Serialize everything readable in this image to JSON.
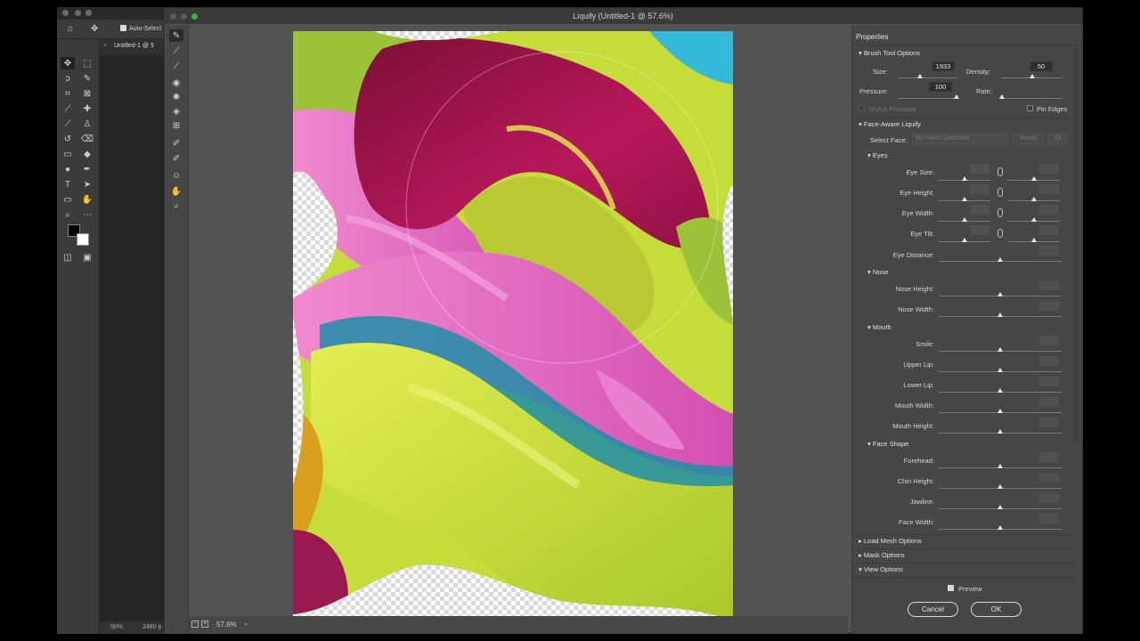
{
  "ps": {
    "options_bar": {
      "auto_select_label": "Auto-Select"
    },
    "tab_label": "Untitled-1 @ 5",
    "status_zoom": "50%",
    "status_size": "2480 p"
  },
  "dialog": {
    "title": "Liquify (Untitled-1 @ 57.6%)",
    "zoom": "57.6%"
  },
  "properties": {
    "header": "Properties",
    "brush_tool_options": {
      "title": "Brush Tool Options",
      "size_label": "Size:",
      "size_value": "1933",
      "size_level": 0.38,
      "density_label": "Density:",
      "density_value": "50",
      "density_level": 0.5,
      "pressure_label": "Pressure:",
      "pressure_value": "100",
      "pressure_level": 1.0,
      "rate_label": "Rate:",
      "rate_level": 0.0,
      "stylus_label": "Stylus Pressure",
      "pin_edges_label": "Pin Edges"
    },
    "face_aware": {
      "title": "Face-Aware Liquify",
      "select_face_label": "Select Face:",
      "select_face_value": "No Faces Detected",
      "reset_label": "Reset",
      "all_label": "All",
      "eyes_title": "Eyes",
      "eye_size": "Eye Size:",
      "eye_height": "Eye Height:",
      "eye_width": "Eye Width:",
      "eye_tilt": "Eye Tilt:",
      "eye_distance": "Eye Distance:",
      "nose_title": "Nose",
      "nose_height": "Nose Height:",
      "nose_width": "Nose Width:",
      "mouth_title": "Mouth",
      "smile": "Smile:",
      "upper_lip": "Upper Lip:",
      "lower_lip": "Lower Lip:",
      "mouth_width": "Mouth Width:",
      "mouth_height": "Mouth Height:",
      "face_shape_title": "Face Shape",
      "forehead": "Forehead:",
      "chin_height": "Chin Height:",
      "jawline": "Jawline:",
      "face_width": "Face Width:"
    },
    "load_mesh_options": "Load Mesh Options",
    "mask_options": "Mask Options",
    "view_options": "View Options",
    "preview_label": "Preview",
    "cancel_label": "Cancel",
    "ok_label": "OK"
  },
  "colors": {
    "accent_magenta": "#a0164f",
    "accent_pink": "#e66fc7",
    "accent_lime": "#c6dc3a",
    "accent_teal": "#1f8ea8"
  }
}
